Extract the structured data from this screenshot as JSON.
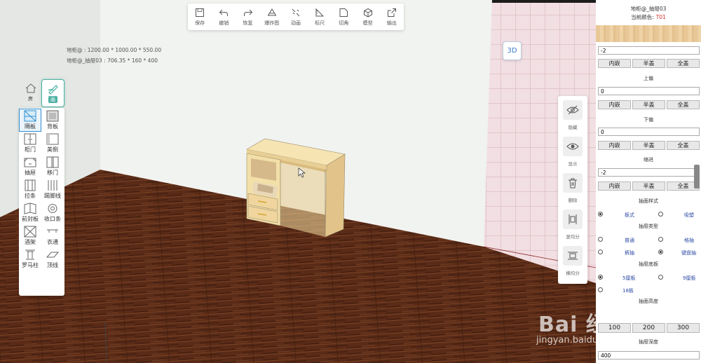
{
  "toolbar": {
    "items": [
      {
        "label": "保存",
        "icon": "save-icon"
      },
      {
        "label": "撤销",
        "icon": "undo-icon"
      },
      {
        "label": "恢复",
        "icon": "redo-icon"
      },
      {
        "label": "爆炸图",
        "icon": "explode-icon"
      },
      {
        "label": "动画",
        "icon": "animation-icon"
      },
      {
        "label": "标尺",
        "icon": "ruler-icon"
      },
      {
        "label": "切角",
        "icon": "chamfer-icon"
      },
      {
        "label": "模型",
        "icon": "model-icon"
      },
      {
        "label": "输出",
        "icon": "export-icon"
      }
    ]
  },
  "info": {
    "line1": "地柜@ : 1200.00 * 1000.00 * 550.00",
    "line2": "地柜@_抽屉03 : 706.35 * 160 * 400"
  },
  "view_toggle": "3D",
  "mode_tabs": [
    {
      "label": "房",
      "icon": "house-icon"
    },
    {
      "label": "画",
      "icon": "draw-icon"
    }
  ],
  "tools": [
    {
      "label": "隔板",
      "icon": "shelf-icon"
    },
    {
      "label": "背板",
      "icon": "back-panel-icon"
    },
    {
      "label": "柜门",
      "icon": "cabinet-door-icon"
    },
    {
      "label": "美侧",
      "icon": "side-panel-icon"
    },
    {
      "label": "抽屉",
      "icon": "drawer-icon"
    },
    {
      "label": "移门",
      "icon": "sliding-door-icon"
    },
    {
      "label": "拉条",
      "icon": "strip-icon"
    },
    {
      "label": "踢脚线",
      "icon": "skirting-icon"
    },
    {
      "label": "前封板",
      "icon": "front-cover-icon"
    },
    {
      "label": "收口条",
      "icon": "closing-strip-icon"
    },
    {
      "label": "酒架",
      "icon": "wine-rack-icon"
    },
    {
      "label": "衣通",
      "icon": "hanging-rod-icon"
    },
    {
      "label": "罗马柱",
      "icon": "roman-column-icon"
    },
    {
      "label": "顶线",
      "icon": "crown-line-icon"
    }
  ],
  "vtools": [
    {
      "label": "隐藏",
      "icon": "hide-eye-icon"
    },
    {
      "label": "显示",
      "icon": "show-eye-icon"
    },
    {
      "label": "删除",
      "icon": "trash-icon"
    },
    {
      "label": "竖均分",
      "icon": "vertical-split-icon"
    },
    {
      "label": "横均分",
      "icon": "horizontal-split-icon"
    }
  ],
  "panel": {
    "title": "地柜@_抽屉03",
    "color_label": "当前颜色:",
    "color_code": "T01",
    "inputs": [
      "-2",
      "0",
      "0",
      "-2"
    ],
    "labels": [
      "上偏",
      "下偏",
      "缩进",
      "抽面样式",
      "抽屉类型",
      "抽屉底板",
      "抽面高度",
      "抽屉深度"
    ],
    "inset_buttons": [
      "内嵌",
      "半盖",
      "全盖"
    ],
    "face_style": {
      "a": "板式",
      "b": "吸塑"
    },
    "drawer_type": {
      "a": "普通",
      "b": "格抽",
      "c": "裤抽",
      "d": "键盘抽"
    },
    "bottom_board": {
      "a": "5厘板",
      "b": "9厘板",
      "c": "18板"
    },
    "heights": [
      "100",
      "200",
      "300"
    ],
    "depth_value": "400"
  },
  "watermark": {
    "logo": "Bai 经验",
    "url": "jingyan.baidu.com"
  },
  "colors": {
    "floor": "#5a2b17",
    "wall": "#f1f3f0",
    "accent": "#4db1a3",
    "panel_bg": "#ffffff"
  }
}
